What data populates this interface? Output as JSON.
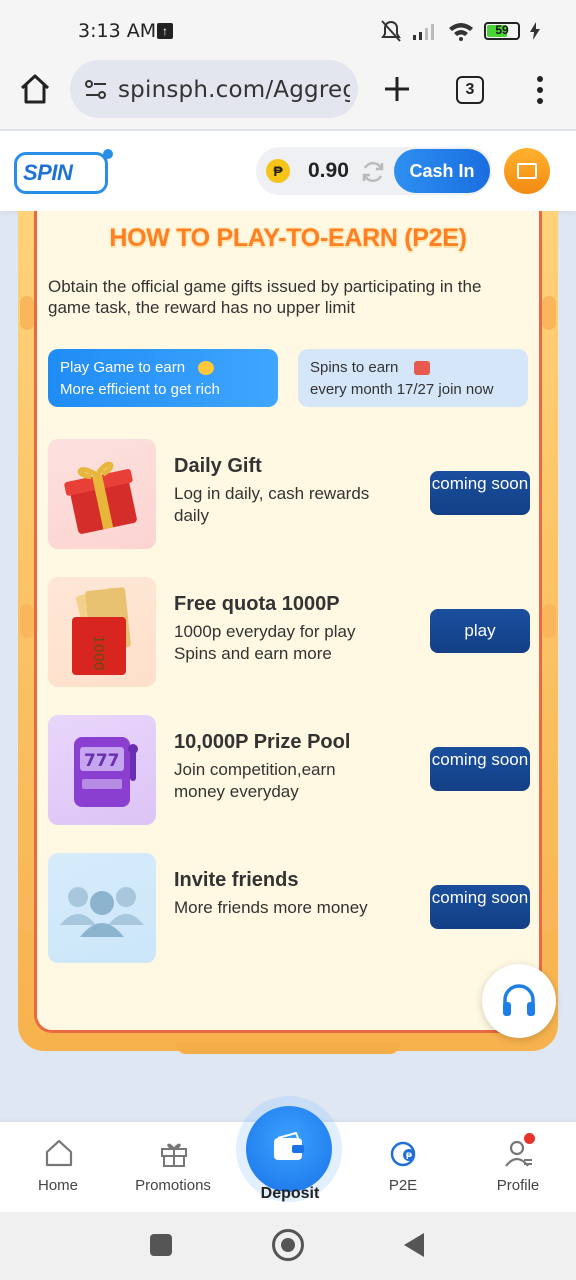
{
  "status_bar": {
    "time": "3:13 AM",
    "battery": "59"
  },
  "browser": {
    "url": "spinsph.com/Aggregate",
    "tab_count": "3"
  },
  "header": {
    "logo": "SPIN",
    "currency_symbol": "₱",
    "balance": "0.90",
    "cash_in_label": "Cash In"
  },
  "main": {
    "headline": "HOW TO PLAY-TO-EARN (P2E)",
    "description": "Obtain the official game gifts issued by participating in the game task, the reward has no upper limit",
    "chips": [
      {
        "line1": "Play Game to earn",
        "line2": "More efficient to get rich"
      },
      {
        "line1": "Spins to earn",
        "line2": "every month 17/27 join now"
      }
    ],
    "tasks": [
      {
        "title": "Daily Gift",
        "desc": "Log in daily, cash rewards daily",
        "button": "coming soon"
      },
      {
        "title": "Free quota 1000P",
        "desc": "1000p everyday for play Spins and earn more",
        "button": "play",
        "thumb_text": "1000"
      },
      {
        "title": "10,000P Prize Pool",
        "desc": "Join competition,earn money everyday",
        "button": "coming soon",
        "thumb_text": "777"
      },
      {
        "title": "Invite friends",
        "desc": "More friends more money",
        "button": "coming soon"
      }
    ]
  },
  "bottom_nav": {
    "items": [
      "Home",
      "Promotions",
      "Deposit",
      "P2E",
      "Profile"
    ]
  },
  "colors": {
    "primary_blue": "#1f8cf5",
    "button_navy": "#16468f",
    "headline_orange": "#ff7f22",
    "frame_red": "#e86a43",
    "card_bg": "#fff8e2"
  }
}
